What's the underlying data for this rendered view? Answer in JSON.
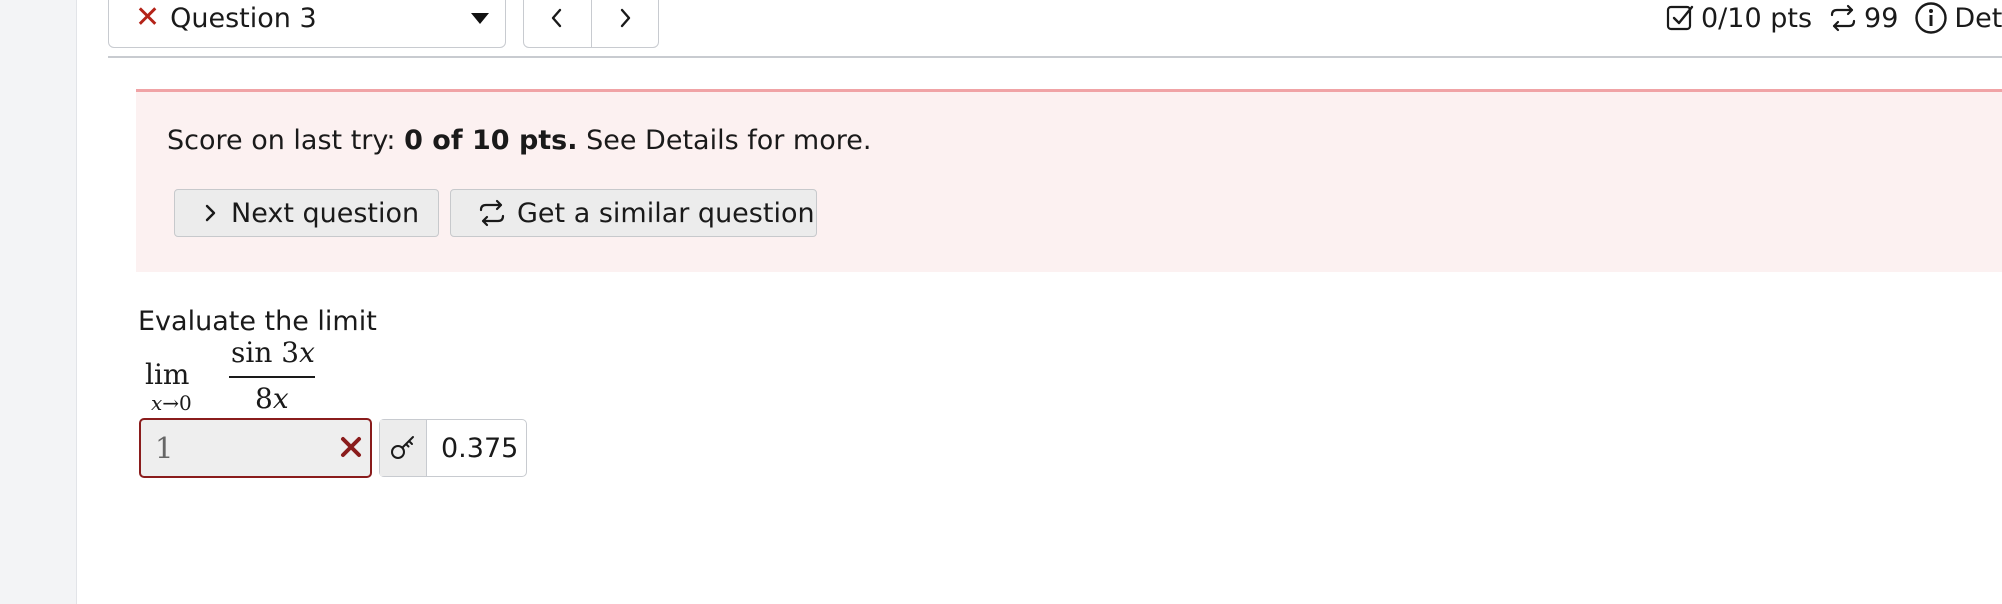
{
  "header": {
    "question_select": {
      "label": "Question 3",
      "status_icon": "x-icon"
    },
    "nav": {
      "prev_icon": "chevron-left-icon",
      "next_icon": "chevron-right-icon"
    },
    "points": "0/10 pts",
    "attempts": "99",
    "details": "Det"
  },
  "score_panel": {
    "prefix": "Score on last try: ",
    "score": "0 of 10 pts.",
    "suffix": " See Details for more.",
    "next_button": "Next question",
    "similar_button": "Get a similar question"
  },
  "question": {
    "prompt": "Evaluate the limit",
    "lim": "lim",
    "lim_var": "x",
    "lim_arrow": "→",
    "lim_target": "0",
    "numerator_fn": "sin 3",
    "numerator_var": "x",
    "denominator_coef": "8",
    "denominator_var": "x"
  },
  "answer": {
    "value": "1",
    "status": "incorrect",
    "correct_value": "0.375"
  },
  "colors": {
    "error_red": "#b42318",
    "panel_bg": "#fcf1f1",
    "panel_border": "#f0a3a6",
    "answer_border": "#8a1c1c"
  }
}
